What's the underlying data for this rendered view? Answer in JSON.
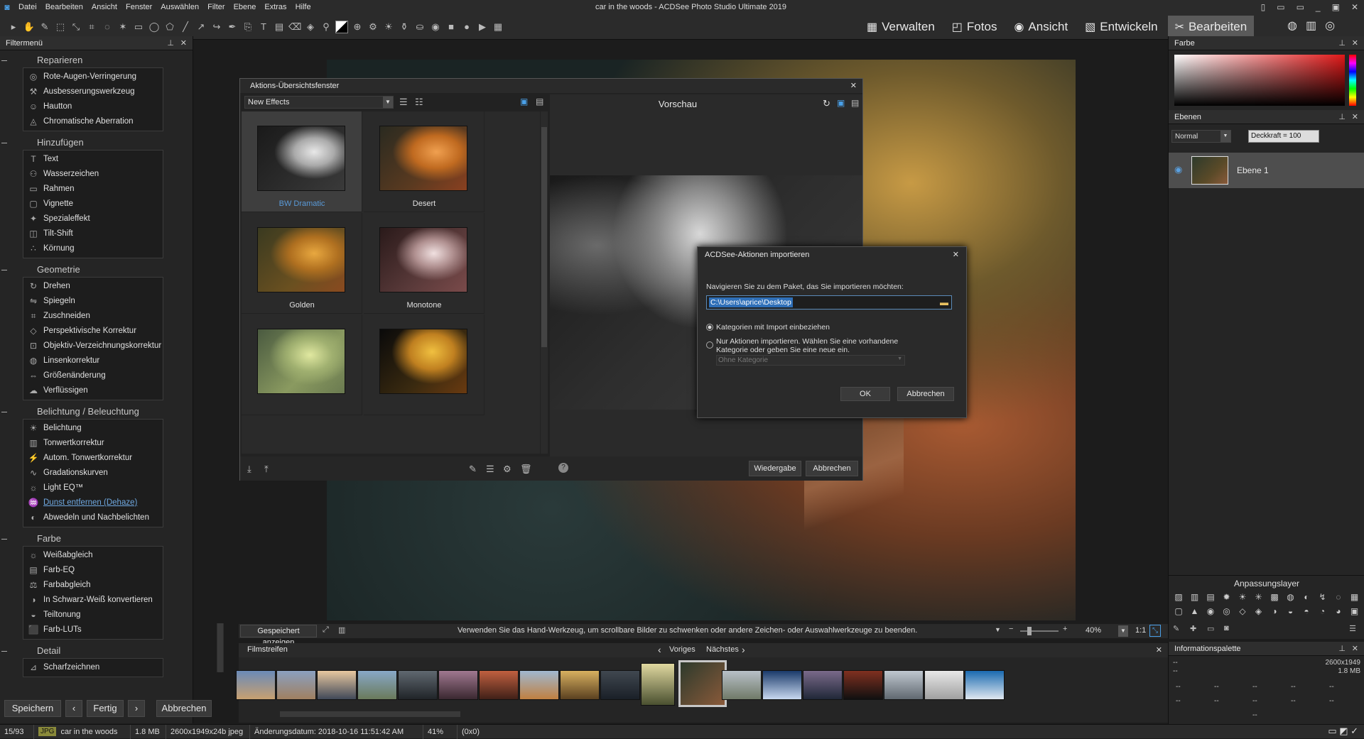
{
  "app": {
    "title": "car in the woods - ACDSee Photo Studio Ultimate 2019"
  },
  "menu": [
    "Datei",
    "Bearbeiten",
    "Ansicht",
    "Fenster",
    "Auswählen",
    "Filter",
    "Ebene",
    "Extras",
    "Hilfe"
  ],
  "modes": [
    {
      "label": "Verwalten",
      "icon": "grid-icon"
    },
    {
      "label": "Fotos",
      "icon": "photos-icon"
    },
    {
      "label": "Ansicht",
      "icon": "eye-icon"
    },
    {
      "label": "Entwickeln",
      "icon": "develop-icon"
    },
    {
      "label": "Bearbeiten",
      "icon": "edit-icon",
      "active": true
    }
  ],
  "filter_panel": {
    "title": "Filtermenü",
    "sections": [
      {
        "title": "Reparieren",
        "items": [
          "Rote-Augen-Verringerung",
          "Ausbesserungswerkzeug",
          "Hautton",
          "Chromatische Aberration"
        ]
      },
      {
        "title": "Hinzufügen",
        "items": [
          "Text",
          "Wasserzeichen",
          "Rahmen",
          "Vignette",
          "Spezialeffekt",
          "Tilt-Shift",
          "Körnung"
        ]
      },
      {
        "title": "Geometrie",
        "items": [
          "Drehen",
          "Spiegeln",
          "Zuschneiden",
          "Perspektivische Korrektur",
          "Objektiv-Verzeichnungskorrektur",
          "Linsenkorrektur",
          "Größenänderung",
          "Verflüssigen"
        ]
      },
      {
        "title": "Belichtung / Beleuchtung",
        "items": [
          "Belichtung",
          "Tonwertkorrektur",
          "Autom. Tonwertkorrektur",
          "Gradationskurven",
          "Light EQ™",
          "Dunst entfernen (Dehaze)",
          "Abwedeln und Nachbelichten"
        ]
      },
      {
        "title": "Farbe",
        "items": [
          "Weißabgleich",
          "Farb-EQ",
          "Farbabgleich",
          "In Schwarz-Weiß konvertieren",
          "Teiltonung",
          "Farb-LUTs"
        ]
      },
      {
        "title": "Detail",
        "items": [
          "Scharfzeichnen"
        ]
      }
    ]
  },
  "bottom_buttons": {
    "save": "Speichern",
    "done": "Fertig",
    "cancel": "Abbrechen"
  },
  "actions_window": {
    "title": "Aktions-Übersichtsfenster",
    "category": "New Effects",
    "preview_label": "Vorschau",
    "thumbs": [
      {
        "label": "BW Dramatic",
        "selected": true
      },
      {
        "label": "Desert"
      },
      {
        "label": "Golden"
      },
      {
        "label": "Monotone"
      },
      {
        "label": ""
      },
      {
        "label": ""
      }
    ],
    "play": "Wiedergabe",
    "cancel": "Abbrechen"
  },
  "import_dialog": {
    "title": "ACDSee-Aktionen importieren",
    "prompt": "Navigieren Sie zu dem Paket, das Sie importieren möchten:",
    "path": "C:\\Users\\aprice\\Desktop",
    "opt1": "Kategorien mit Import einbeziehen",
    "opt2": "Nur Aktionen importieren. Wählen Sie eine vorhandene Kategorie oder geben Sie eine neue ein.",
    "category_placeholder": "Ohne Kategorie",
    "ok": "OK",
    "cancel": "Abbrechen"
  },
  "canvas_status": {
    "saved": "Gespeichert anzeigen",
    "hint": "Verwenden Sie das Hand-Werkzeug, um scrollbare Bilder zu schwenken oder andere Zeichen- oder Auswahlwerkzeuge zu beenden.",
    "zoom": "40%",
    "ratio": "1:1"
  },
  "filmstrip": {
    "title": "Filmstreifen",
    "prev": "Voriges",
    "next": "Nächstes"
  },
  "color_panel": {
    "title": "Farbe"
  },
  "layers_panel": {
    "title": "Ebenen",
    "blend": "Normal",
    "opacity": "Deckkraft = 100",
    "layer": "Ebene 1"
  },
  "adjust_panel": {
    "title": "Anpassungslayer"
  },
  "info_panel": {
    "title": "Informationspalette",
    "rows": [
      [
        "--",
        "2600x1949"
      ],
      [
        "--",
        "1.8 MB"
      ]
    ],
    "grid": [
      "--",
      "--",
      "--",
      "--",
      "--",
      "--",
      "--",
      "--",
      "--",
      "--",
      "--"
    ]
  },
  "statusbar": {
    "index": "15/93",
    "format": "JPG",
    "name": "car in the woods",
    "size": "1.8 MB",
    "dims": "2600x1949x24b jpeg",
    "modified": "Änderungsdatum: 2018-10-16 11:51:42 AM",
    "zoom": "41%",
    "coords": "(0x0)"
  }
}
